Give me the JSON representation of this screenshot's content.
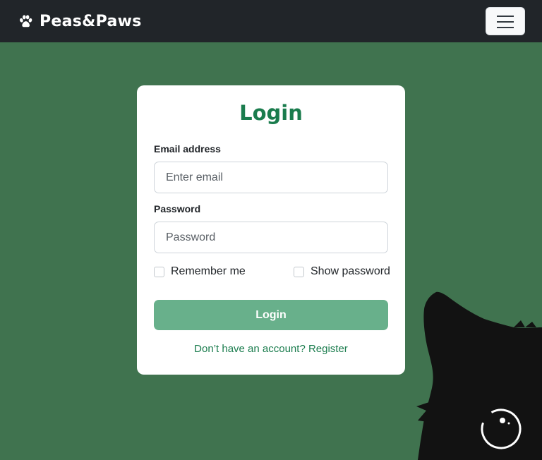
{
  "navbar": {
    "brand": "Peas&Paws",
    "brand_icon": "paw-icon",
    "menu_icon": "hamburger-menu-icon"
  },
  "login_form": {
    "title": "Login",
    "email_label": "Email address",
    "email_placeholder": "Enter email",
    "email_value": "",
    "password_label": "Password",
    "password_placeholder": "Password",
    "password_value": "",
    "remember_label": "Remember me",
    "remember_checked": false,
    "show_password_label": "Show password",
    "show_password_checked": false,
    "submit_label": "Login",
    "register_prompt": "Don’t have an account? Register"
  },
  "decoration": {
    "cat_icon": "black-cat-silhouette"
  },
  "colors": {
    "background": "#40734f",
    "navbar": "#212529",
    "accent": "#1a7c4d",
    "button": "#68b08b"
  }
}
